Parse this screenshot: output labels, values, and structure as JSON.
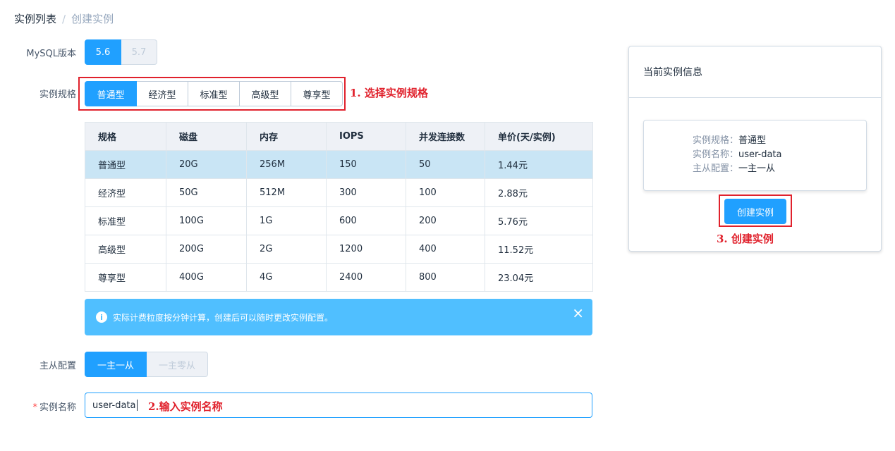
{
  "breadcrumb": {
    "parent": "实例列表",
    "separator": "/",
    "current": "创建实例"
  },
  "version": {
    "label": "MySQL版本",
    "options": [
      "5.6",
      "5.7"
    ],
    "selected": "5.6"
  },
  "spec": {
    "label": "实例规格",
    "options": [
      "普通型",
      "经济型",
      "标准型",
      "高级型",
      "尊享型"
    ],
    "selected": "普通型",
    "annotation": "1. 选择实例规格"
  },
  "table": {
    "headers": [
      "规格",
      "磁盘",
      "内存",
      "IOPS",
      "并发连接数",
      "单价(天/实例)"
    ],
    "rows": [
      [
        "普通型",
        "20G",
        "256M",
        "150",
        "50",
        "1.44元"
      ],
      [
        "经济型",
        "50G",
        "512M",
        "300",
        "100",
        "2.88元"
      ],
      [
        "标准型",
        "100G",
        "1G",
        "600",
        "200",
        "5.76元"
      ],
      [
        "高级型",
        "200G",
        "2G",
        "1200",
        "400",
        "11.52元"
      ],
      [
        "尊享型",
        "400G",
        "4G",
        "2400",
        "800",
        "23.04元"
      ]
    ]
  },
  "alert": {
    "icon": "info-icon",
    "text": "实际计费粒度按分钟计算，创建后可以随时更改实例配置。",
    "close": "×"
  },
  "replica": {
    "label": "主从配置",
    "options": [
      "一主一从",
      "一主零从"
    ],
    "selected": "一主一从"
  },
  "name": {
    "required": "*",
    "label": "实例名称",
    "value": "user-data",
    "annotation": "2.输入实例名称"
  },
  "info_panel": {
    "title": "当前实例信息",
    "rows": [
      {
        "key": "实例规格：",
        "value": "普通型"
      },
      {
        "key": "实例名称：",
        "value": "user-data"
      },
      {
        "key": "主从配置：",
        "value": "一主一从"
      }
    ],
    "create_button": "创建实例",
    "annotation": "3. 创建实例"
  },
  "colors": {
    "primary": "#20a0ff",
    "alert": "#50bfff",
    "annotation": "#e0212c",
    "selected_row": "#c9e5f5"
  }
}
